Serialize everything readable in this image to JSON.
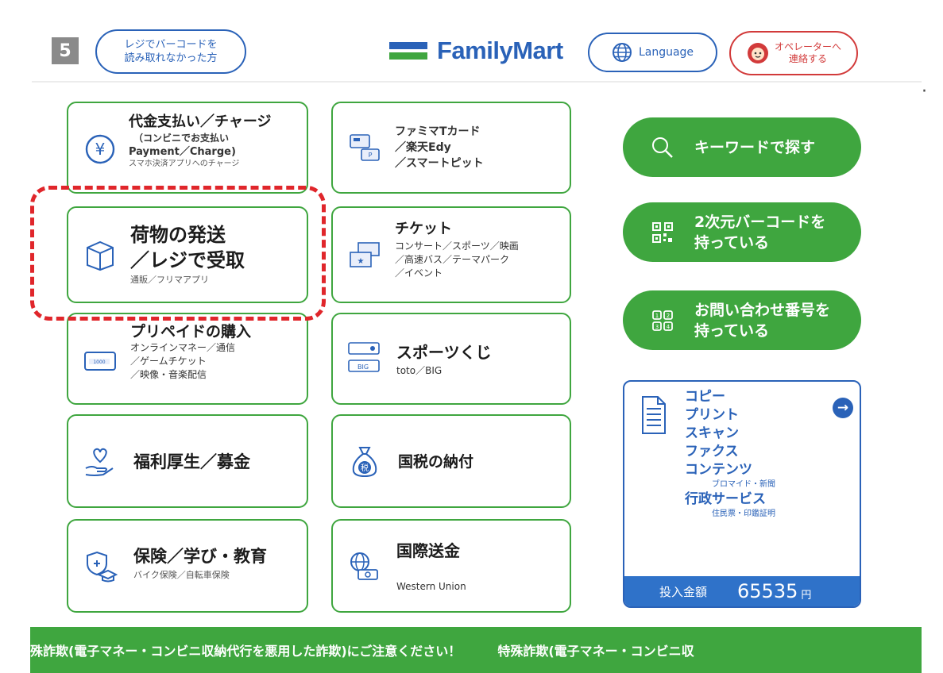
{
  "header": {
    "page_number": "5",
    "barcode_help": {
      "line1": "レジでバーコードを",
      "line2": "読み取れなかった方"
    },
    "logo_text": "FamilyMart",
    "language_label": "Language",
    "operator": {
      "line1": "オペレーターへ",
      "line2": "連絡する"
    }
  },
  "tiles": {
    "payment": {
      "title": "代金支払い／チャージ",
      "sub1": "（コンビニでお支払い",
      "sub2": "Payment／Charge)",
      "sub3": "スマホ決済アプリへのチャージ"
    },
    "famima_card": {
      "line1": "ファミマTカード",
      "line2": "／楽天Edy",
      "line3": "／スマートピット"
    },
    "shipping": {
      "line1": "荷物の発送",
      "line2": "／レジで受取",
      "sub": "通販／フリマアプリ"
    },
    "ticket": {
      "title": "チケット",
      "sub1": "コンサート／スポーツ／映画",
      "sub2": "／高速バス／テーマパーク",
      "sub3": "／イベント"
    },
    "prepaid": {
      "title": "プリペイドの購入",
      "sub1": "オンラインマネー／通信",
      "sub2": "／ゲームチケット",
      "sub3": "／映像・音楽配信"
    },
    "sports_lottery": {
      "title": "スポーツくじ",
      "sub": "toto／BIG"
    },
    "welfare": {
      "title": "福利厚生／募金"
    },
    "national_tax": {
      "title": "国税の納付"
    },
    "insurance": {
      "title": "保険／学び・教育",
      "sub": "バイク保険／自転車保険"
    },
    "remittance": {
      "title": "国際送金",
      "sub": "Western Union"
    }
  },
  "green_buttons": {
    "keyword": {
      "label": "キーワードで探す"
    },
    "qr": {
      "line1": "2次元バーコードを",
      "line2": "持っている"
    },
    "inquiry": {
      "line1": "お問い合わせ番号を",
      "line2": "持っている"
    }
  },
  "copy_panel": {
    "items": [
      "コピー",
      "プリント",
      "スキャン",
      "ファクス",
      "コンテンツ"
    ],
    "contents_sub": "ブロマイド・新聞",
    "gov_service": "行政サービス",
    "gov_sub": "住民票・印鑑証明",
    "deposit_label": "投入金額",
    "deposit_value": "65535",
    "deposit_unit": "円"
  },
  "ticker": {
    "text1": "殊詐欺(電子マネー・コンビニ収納代行を悪用した詐欺)にご注意ください！",
    "text2": "特殊詐欺(電子マネー・コンビニ収"
  },
  "colors": {
    "green": "#3fa63f",
    "blue": "#2a62b8",
    "red": "#e0262b"
  }
}
